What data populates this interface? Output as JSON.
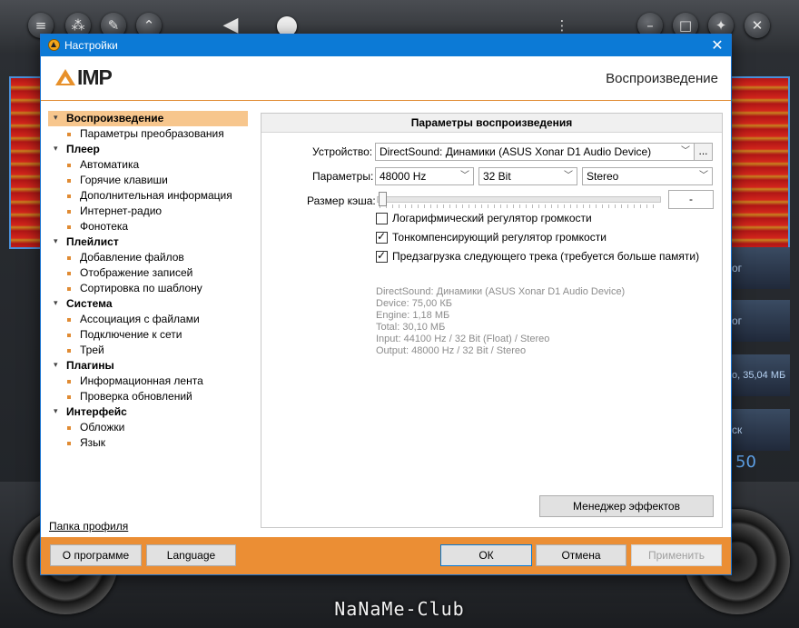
{
  "background_player": {
    "footer_logo": "NaNaMe-Club",
    "side_texts": [
      "гг",
      "ог",
      "о, 35,04 МБ",
      "ск"
    ],
    "counter": "50"
  },
  "dialog": {
    "title": "Настройки",
    "close_glyph": "✕",
    "logo_text": "IMP",
    "section_title": "Воспроизведение"
  },
  "tree": [
    {
      "type": "group",
      "label": "Воспроизведение",
      "selected": true
    },
    {
      "type": "item",
      "label": "Параметры преобразования"
    },
    {
      "type": "group",
      "label": "Плеер"
    },
    {
      "type": "item",
      "label": "Автоматика"
    },
    {
      "type": "item",
      "label": "Горячие клавиши"
    },
    {
      "type": "item",
      "label": "Дополнительная информация"
    },
    {
      "type": "item",
      "label": "Интернет-радио"
    },
    {
      "type": "item",
      "label": "Фонотека"
    },
    {
      "type": "group",
      "label": "Плейлист"
    },
    {
      "type": "item",
      "label": "Добавление файлов"
    },
    {
      "type": "item",
      "label": "Отображение записей"
    },
    {
      "type": "item",
      "label": "Сортировка по шаблону"
    },
    {
      "type": "group",
      "label": "Система"
    },
    {
      "type": "item",
      "label": "Ассоциация с файлами"
    },
    {
      "type": "item",
      "label": "Подключение к сети"
    },
    {
      "type": "item",
      "label": "Трей"
    },
    {
      "type": "group",
      "label": "Плагины"
    },
    {
      "type": "item",
      "label": "Информационная лента"
    },
    {
      "type": "item",
      "label": "Проверка обновлений"
    },
    {
      "type": "group",
      "label": "Интерфейс"
    },
    {
      "type": "item",
      "label": "Обложки"
    },
    {
      "type": "item",
      "label": "Язык"
    }
  ],
  "profile_link": "Папка профиля",
  "panel": {
    "header": "Параметры воспроизведения",
    "device_label": "Устройство:",
    "device_value": "DirectSound: Динамики (ASUS Xonar D1 Audio Device)",
    "device_more": "...",
    "params_label": "Параметры:",
    "rate_value": "48000 Hz",
    "bits_value": "32 Bit",
    "channels_value": "Stereo",
    "cache_label": "Размер кэша:",
    "cache_value": "-",
    "cache_level": 0,
    "checkboxes": [
      {
        "label": "Логарифмический регулятор громкости",
        "checked": false
      },
      {
        "label": "Тонкомпенсирующий регулятор громкости",
        "checked": true
      },
      {
        "label": "Предзагрузка следующего трека (требуется больше памяти)",
        "checked": true
      }
    ],
    "info_lines": [
      "DirectSound: Динамики (ASUS Xonar D1 Audio Device)",
      "Device: 75,00 КБ",
      "Engine: 1,18 МБ",
      "Total: 30,10 МБ",
      "Input: 44100 Hz / 32 Bit (Float) / Stereo",
      "Output: 48000 Hz / 32 Bit / Stereo"
    ],
    "effects_button": "Менеджер эффектов"
  },
  "footer": {
    "about": "О программе",
    "language": "Language",
    "ok": "ОК",
    "cancel": "Отмена",
    "apply": "Применить"
  }
}
